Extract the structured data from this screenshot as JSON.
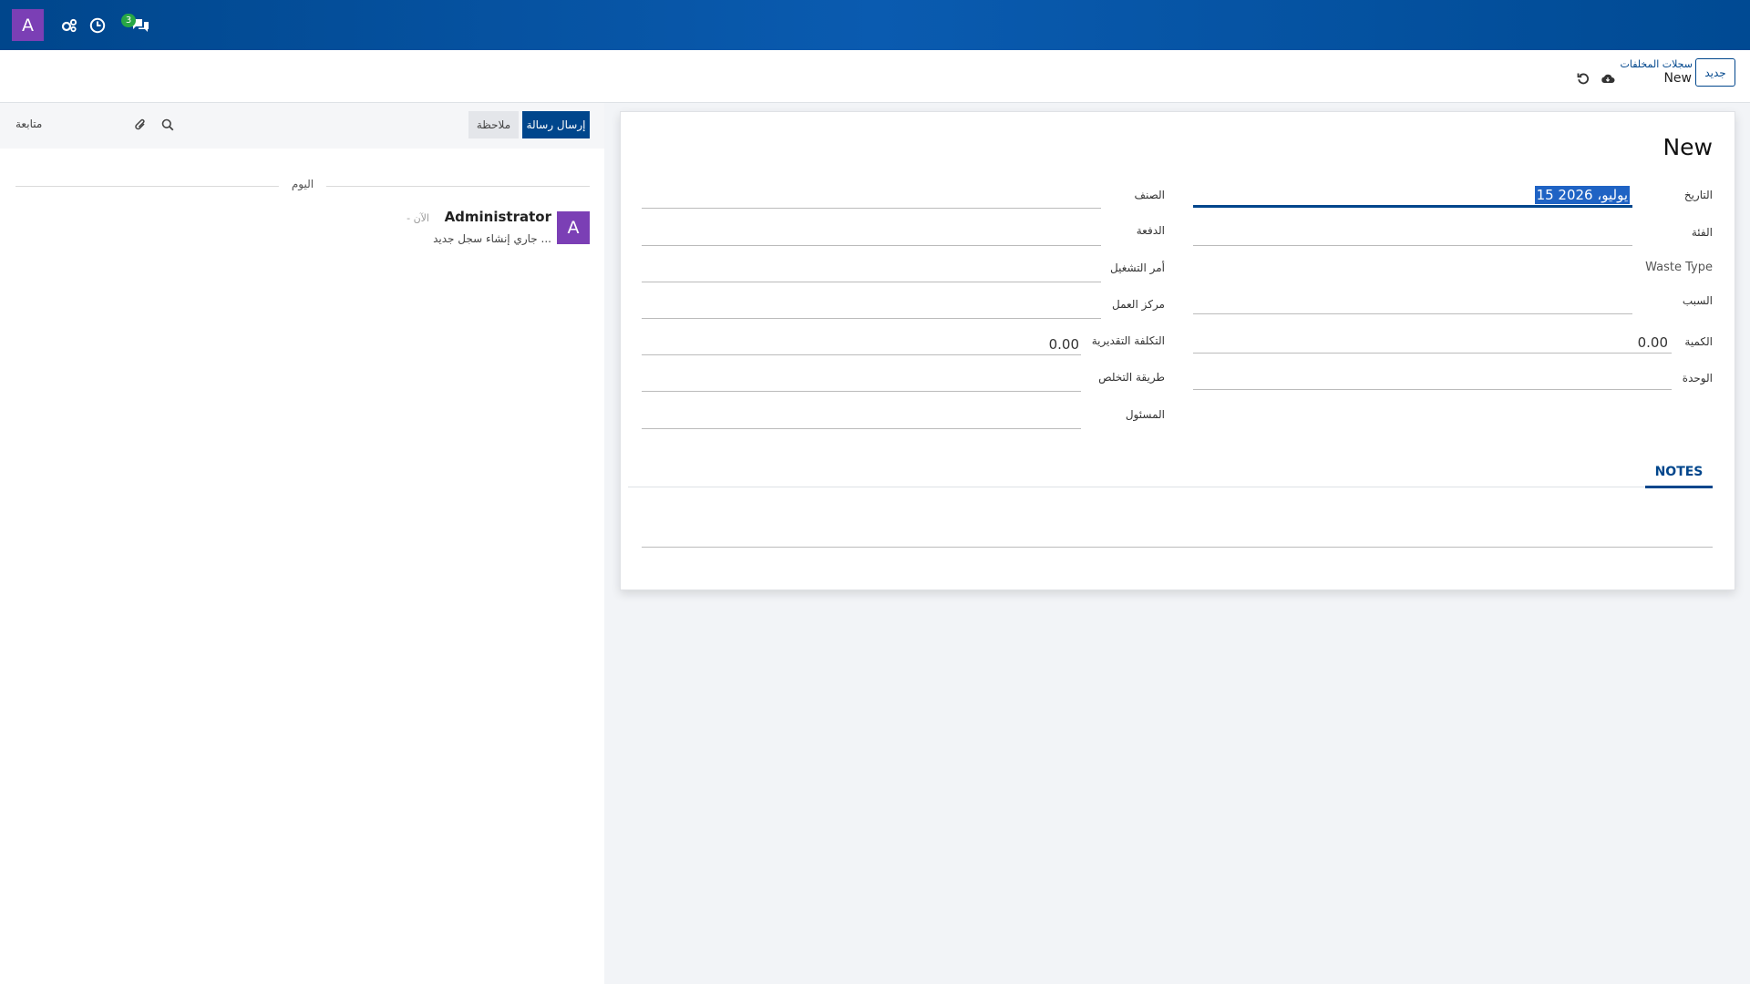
{
  "navbar": {
    "avatar_letter": "A",
    "messages_badge": "3",
    "icons": [
      "activity-icon",
      "clock-icon",
      "chat-icon"
    ],
    "color": "#00468c"
  },
  "control_panel": {
    "new_button": "جديد",
    "breadcrumb_parent": "سجلات المخلفات",
    "breadcrumb_current": "New"
  },
  "form": {
    "title": "New",
    "fields": {
      "date": {
        "label": "التاريخ",
        "value": "15 يوليو، 2026"
      },
      "category": {
        "label": "الفئة",
        "value": ""
      },
      "waste_type": {
        "label": "Waste Type",
        "value": ""
      },
      "reason": {
        "label": "السبب",
        "value": ""
      },
      "quantity": {
        "label": "الكمية",
        "value": "0.00"
      },
      "unit": {
        "label": "الوحدة",
        "value": ""
      },
      "product": {
        "label": "الصنف",
        "value": ""
      },
      "batch": {
        "label": "الدفعة",
        "value": ""
      },
      "work_order": {
        "label": "أمر التشغيل",
        "value": ""
      },
      "work_center": {
        "label": "مركز العمل",
        "value": ""
      },
      "estimated_cost": {
        "label": "التكلفة التقديرية",
        "value": "0.00"
      },
      "disposal_method": {
        "label": "طريقة التخلص",
        "value": ""
      },
      "responsible": {
        "label": "المسئول",
        "value": ""
      }
    },
    "tabs": {
      "notes": "NOTES"
    }
  },
  "chatter": {
    "send_message": "إرسال رسالة",
    "log_note": "ملاحظة",
    "follow": "متابعة",
    "day_label": "اليوم",
    "message": {
      "avatar_letter": "A",
      "author": "Administrator",
      "time": "- الآن",
      "body": "جاري إنشاء سجل جديد ..."
    }
  }
}
